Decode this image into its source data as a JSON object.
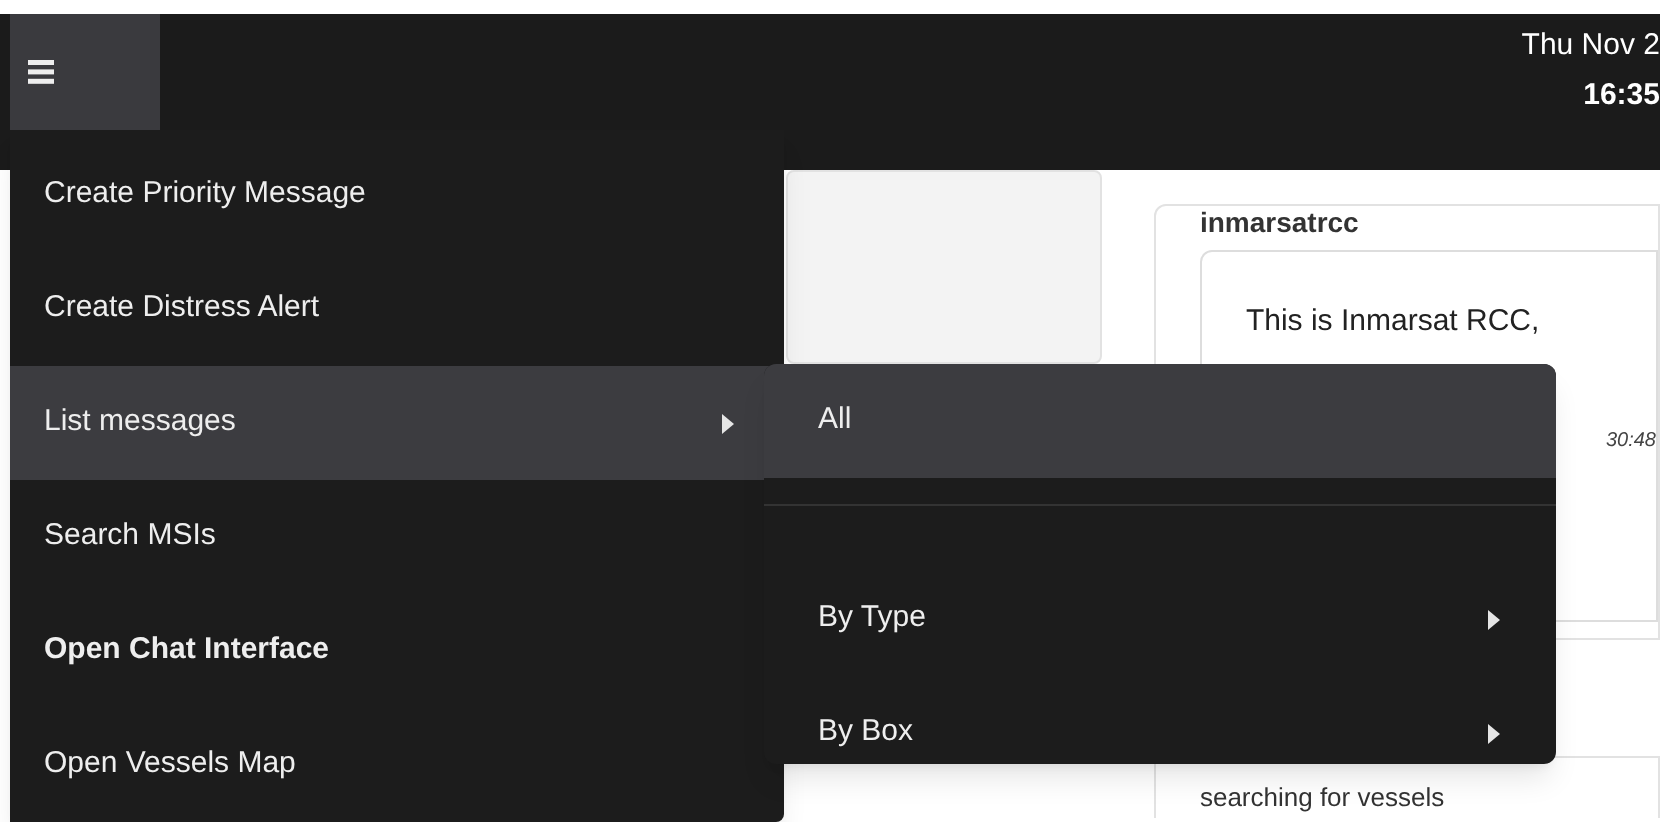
{
  "header": {
    "date": "Thu Nov 2",
    "time": "16:35"
  },
  "menu": {
    "items": [
      {
        "label": "Create Priority Message",
        "selected": false,
        "bold": false,
        "has_submenu": false
      },
      {
        "label": "Create Distress Alert",
        "selected": false,
        "bold": false,
        "has_submenu": false
      },
      {
        "label": "List messages",
        "selected": true,
        "bold": false,
        "has_submenu": true
      },
      {
        "label": "Search MSIs",
        "selected": false,
        "bold": false,
        "has_submenu": false
      },
      {
        "label": "Open Chat Interface",
        "selected": false,
        "bold": true,
        "has_submenu": false
      },
      {
        "label": "Open Vessels Map",
        "selected": false,
        "bold": false,
        "has_submenu": false
      }
    ]
  },
  "submenu": {
    "items": [
      {
        "kind": "item",
        "label": "All",
        "selected": true,
        "has_submenu": false
      },
      {
        "kind": "divider"
      },
      {
        "kind": "item",
        "label": "By Type",
        "selected": false,
        "has_submenu": true
      },
      {
        "kind": "item",
        "label": "By Box",
        "selected": false,
        "has_submenu": true
      }
    ]
  },
  "messages": {
    "sender": "inmarsatrcc",
    "text": "This is Inmarsat RCC,",
    "time": "30:48",
    "next_text": "searching for vessels"
  }
}
